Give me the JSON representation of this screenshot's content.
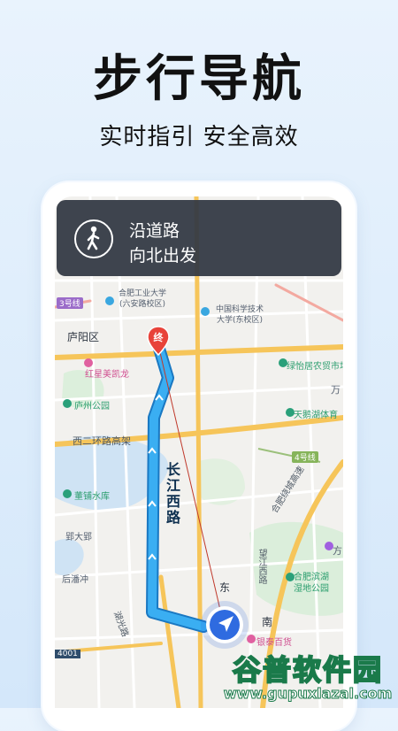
{
  "header": {
    "title": "步行导航",
    "subtitle": "实时指引  安全高效"
  },
  "banner": {
    "icon": "pedestrian-icon",
    "line1": "沿道路",
    "line2": "向北出发"
  },
  "map": {
    "labels": [
      "合肥工业大学\n(六安路校区)",
      "中国科学技术\n大学(东校区)",
      "庐阳区",
      "红星美凯龙",
      "绿怡居农贸市场",
      "庐州公园",
      "天鹅湖体育",
      "西二环路高架",
      "4号线",
      "3号线",
      "董铺水库",
      "郢大郢",
      "合肥绕城高速",
      "合肥滨湖湿地公园",
      "后潘冲",
      "湖光路",
      "银泰百货",
      "望江西路",
      "东",
      "南",
      "4001",
      "万",
      "方"
    ],
    "route_name": "长江西路",
    "end_marker_text": "终"
  },
  "watermark": {
    "title": "谷普软件园",
    "url": "www.gupuxlazal.com"
  },
  "colors": {
    "route": "#2fa4ee",
    "route_outline": "#1a78c2",
    "banner_bg": "#343a44",
    "end_marker": "#e8433a",
    "nav_arrow": "#2f6be0"
  }
}
